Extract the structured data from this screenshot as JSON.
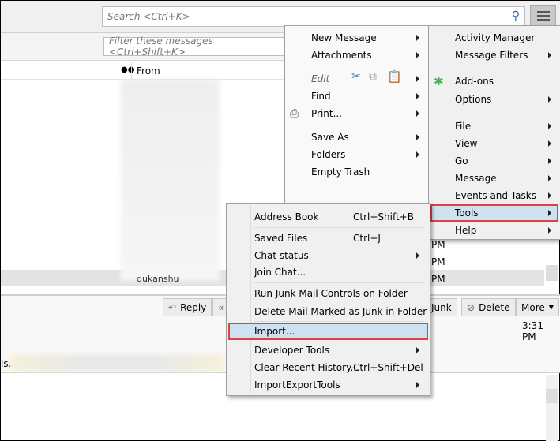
{
  "search": {
    "placeholder": "Search <Ctrl+K>",
    "icon": "search-icon"
  },
  "filter": {
    "placeholder": "Filter these messages <Ctrl+Shift+K>"
  },
  "columns": {
    "from": "From"
  },
  "list": {
    "times": [
      "PM",
      "PM",
      "PM"
    ],
    "selected_sender": "dukanshu"
  },
  "header_buttons": {
    "reply": "Reply",
    "junk": "Junk",
    "delete": "Delete",
    "more": "More"
  },
  "message": {
    "time": "3:31 PM",
    "snippet_prefix": "ls."
  },
  "main_menu": {
    "left": [
      {
        "label": "New Message",
        "submenu": true
      },
      {
        "label": "Attachments",
        "submenu": true
      },
      {
        "label": "Edit",
        "submenu": true
      },
      {
        "label": "Find",
        "submenu": true
      },
      {
        "label": "Print...",
        "submenu": true
      },
      {
        "label": "Save As",
        "submenu": true
      },
      {
        "label": "Folders",
        "submenu": true
      },
      {
        "label": "Empty Trash",
        "submenu": false
      }
    ],
    "right": [
      {
        "label": "Activity Manager"
      },
      {
        "label": "Message Filters",
        "submenu": true
      },
      {
        "label": "Add-ons"
      },
      {
        "label": "Options",
        "submenu": true
      },
      {
        "label": "File",
        "submenu": true
      },
      {
        "label": "View",
        "submenu": true
      },
      {
        "label": "Go",
        "submenu": true
      },
      {
        "label": "Message",
        "submenu": true
      },
      {
        "label": "Events and Tasks",
        "submenu": true
      },
      {
        "label": "Tools",
        "submenu": true,
        "highlighted": true
      },
      {
        "label": "Help",
        "submenu": true
      }
    ]
  },
  "tools_menu": [
    {
      "label": "Address Book",
      "shortcut": "Ctrl+Shift+B"
    },
    {
      "label": "Saved Files",
      "shortcut": "Ctrl+J"
    },
    {
      "label": "Chat status",
      "submenu": true
    },
    {
      "label": "Join Chat..."
    },
    {
      "label": "Run Junk Mail Controls on Folder"
    },
    {
      "label": "Delete Mail Marked as Junk in Folder"
    },
    {
      "label": "Import...",
      "highlighted": true
    },
    {
      "label": "Developer Tools",
      "submenu": true
    },
    {
      "label": "Clear Recent History...",
      "shortcut": "Ctrl+Shift+Del"
    },
    {
      "label": "ImportExportTools",
      "submenu": true
    }
  ],
  "colors": {
    "highlight": "#cfe0f1",
    "highlight_border": "#e04040",
    "menu_bg": "#f0f0f0"
  }
}
